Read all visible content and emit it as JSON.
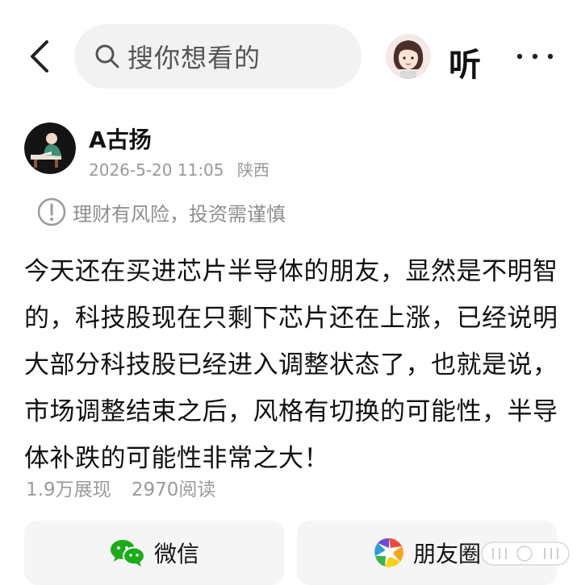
{
  "header": {
    "search_placeholder": "搜你想看的",
    "listen_label": "听"
  },
  "author": {
    "name": "A古扬",
    "datetime": "2026-5-20 11:05",
    "location": "陕西"
  },
  "risk_notice": "理财有风险，投资需谨慎",
  "post": {
    "content": "今天还在买进芯片半导体的朋友，显然是不明智的，科技股现在只剩下芯片还在上涨，已经说明大部分科技股已经进入调整状态了，也就是说，市场调整结束之后，风格有切换的可能性，半导体补跌的可能性非常之大！"
  },
  "stats": {
    "impressions": "1.9万展现",
    "reads": "2970阅读"
  },
  "share": {
    "wechat_label": "微信",
    "moments_label": "朋友圈"
  },
  "colors": {
    "wechat_green": "#1aad19",
    "search_bg": "#f2f2f3",
    "muted_text": "#999999"
  }
}
